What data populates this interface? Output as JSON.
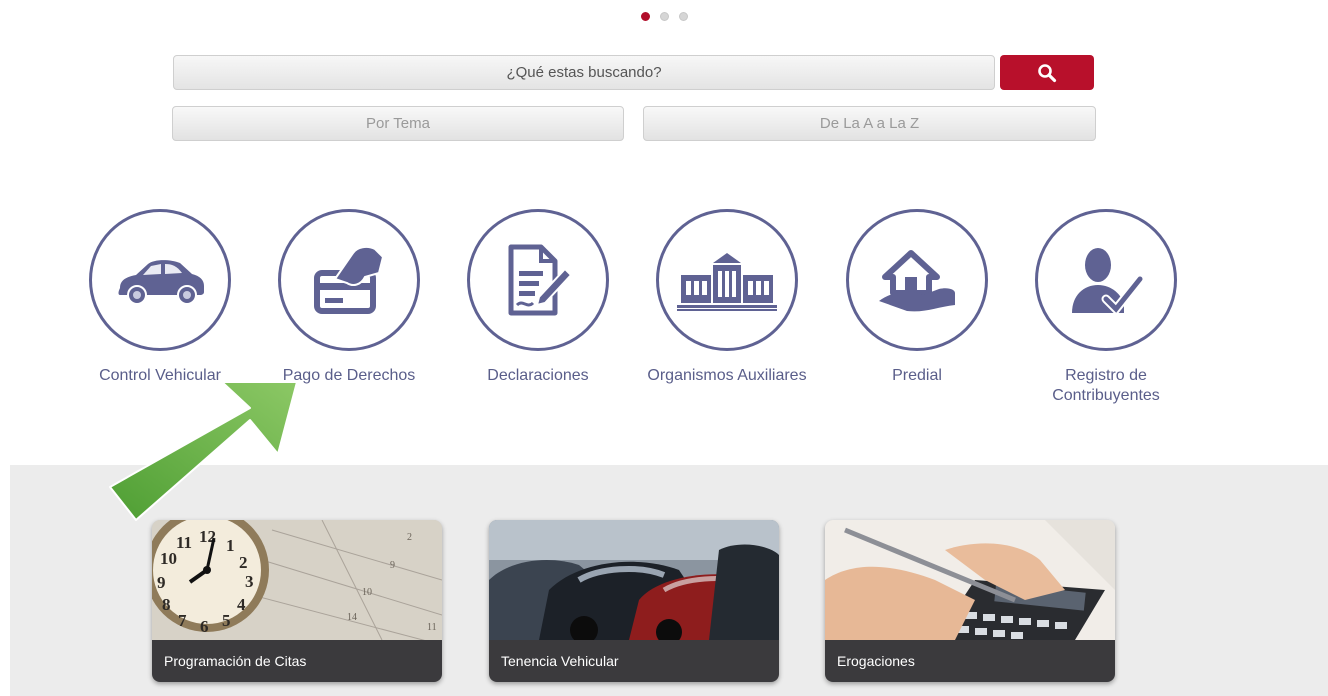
{
  "carousel": {
    "dots": 3,
    "active_index": 0
  },
  "search": {
    "placeholder": "¿Qué estas buscando?",
    "button_icon": "search-icon"
  },
  "filters": {
    "by_topic": "Por Tema",
    "a_to_z": "De La A a La Z"
  },
  "categories": [
    {
      "label": "Control Vehicular",
      "icon": "car-icon"
    },
    {
      "label": "Pago de Derechos",
      "icon": "card-payment-icon"
    },
    {
      "label": "Declaraciones",
      "icon": "document-sign-icon"
    },
    {
      "label": "Organismos Auxiliares",
      "icon": "building-icon"
    },
    {
      "label": "Predial",
      "icon": "house-hand-icon"
    },
    {
      "label": "Registro de\nContribuyentes",
      "icon": "user-check-icon"
    }
  ],
  "highlight_arrow": {
    "color": "#5aab3a",
    "points_to": "Pago de Derechos"
  },
  "cards": [
    {
      "caption": "Programación de Citas",
      "image": "clock-calendar-image"
    },
    {
      "caption": "Tenencia Vehicular",
      "image": "parked-cars-image"
    },
    {
      "caption": "Erogaciones",
      "image": "calculator-image"
    }
  ],
  "colors": {
    "accent": "#b8102b",
    "icon": "#5f6293",
    "label": "#5a5e8a",
    "band": "#ececec",
    "caption_bg": "#3b3a3d"
  }
}
